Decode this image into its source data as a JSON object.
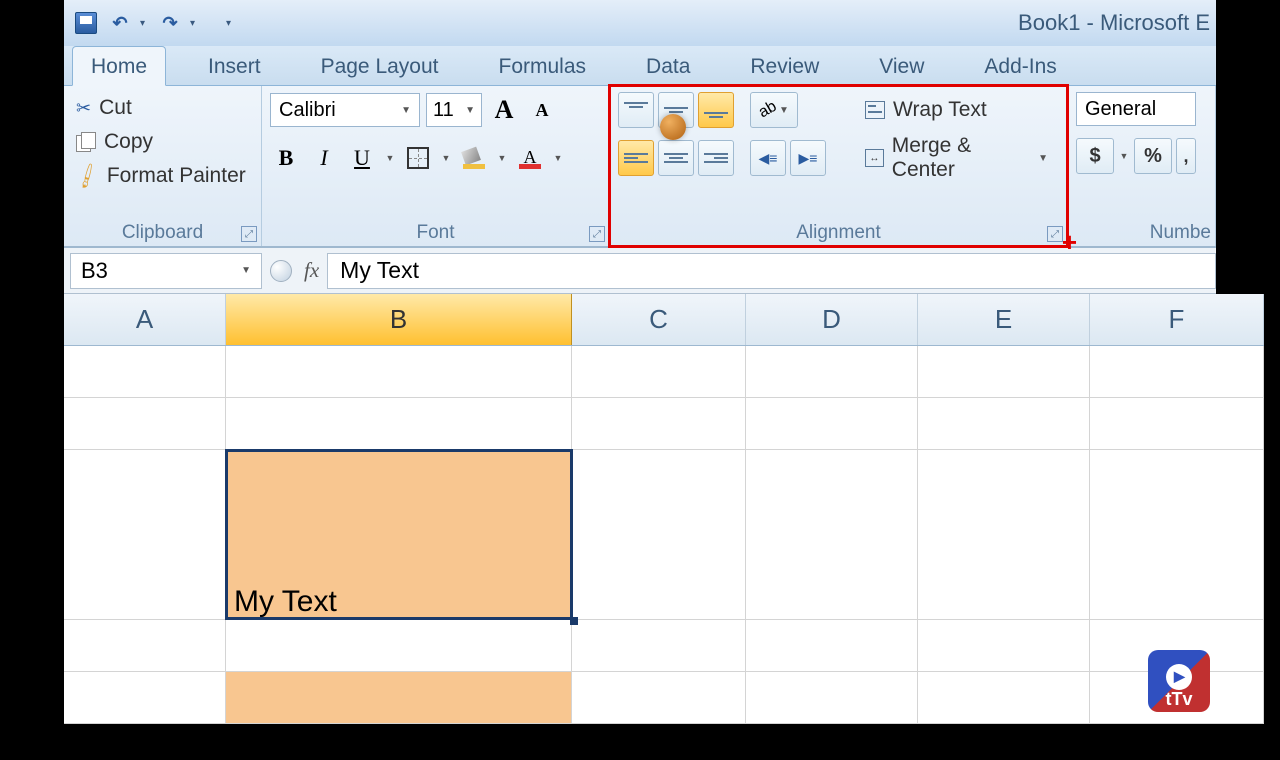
{
  "title": "Book1 - Microsoft E",
  "tabs": [
    "Home",
    "Insert",
    "Page Layout",
    "Formulas",
    "Data",
    "Review",
    "View",
    "Add-Ins"
  ],
  "active_tab": "Home",
  "clipboard": {
    "label": "Clipboard",
    "cut": "Cut",
    "copy": "Copy",
    "format_painter": "Format Painter"
  },
  "font": {
    "label": "Font",
    "name": "Calibri",
    "size": "11"
  },
  "alignment": {
    "label": "Alignment",
    "wrap_text": "Wrap Text",
    "merge_center": "Merge & Center"
  },
  "number": {
    "label": "Numbe",
    "format": "General",
    "currency": "$",
    "percent": "%"
  },
  "name_box": "B3",
  "fx": "fx",
  "formula": "My Text",
  "columns": [
    "A",
    "B",
    "C",
    "D",
    "E",
    "F"
  ],
  "selected_column": "B",
  "selected_cell": {
    "ref": "B3",
    "value": "My Text",
    "fill": "#f8c690"
  },
  "watermark": "tTv"
}
